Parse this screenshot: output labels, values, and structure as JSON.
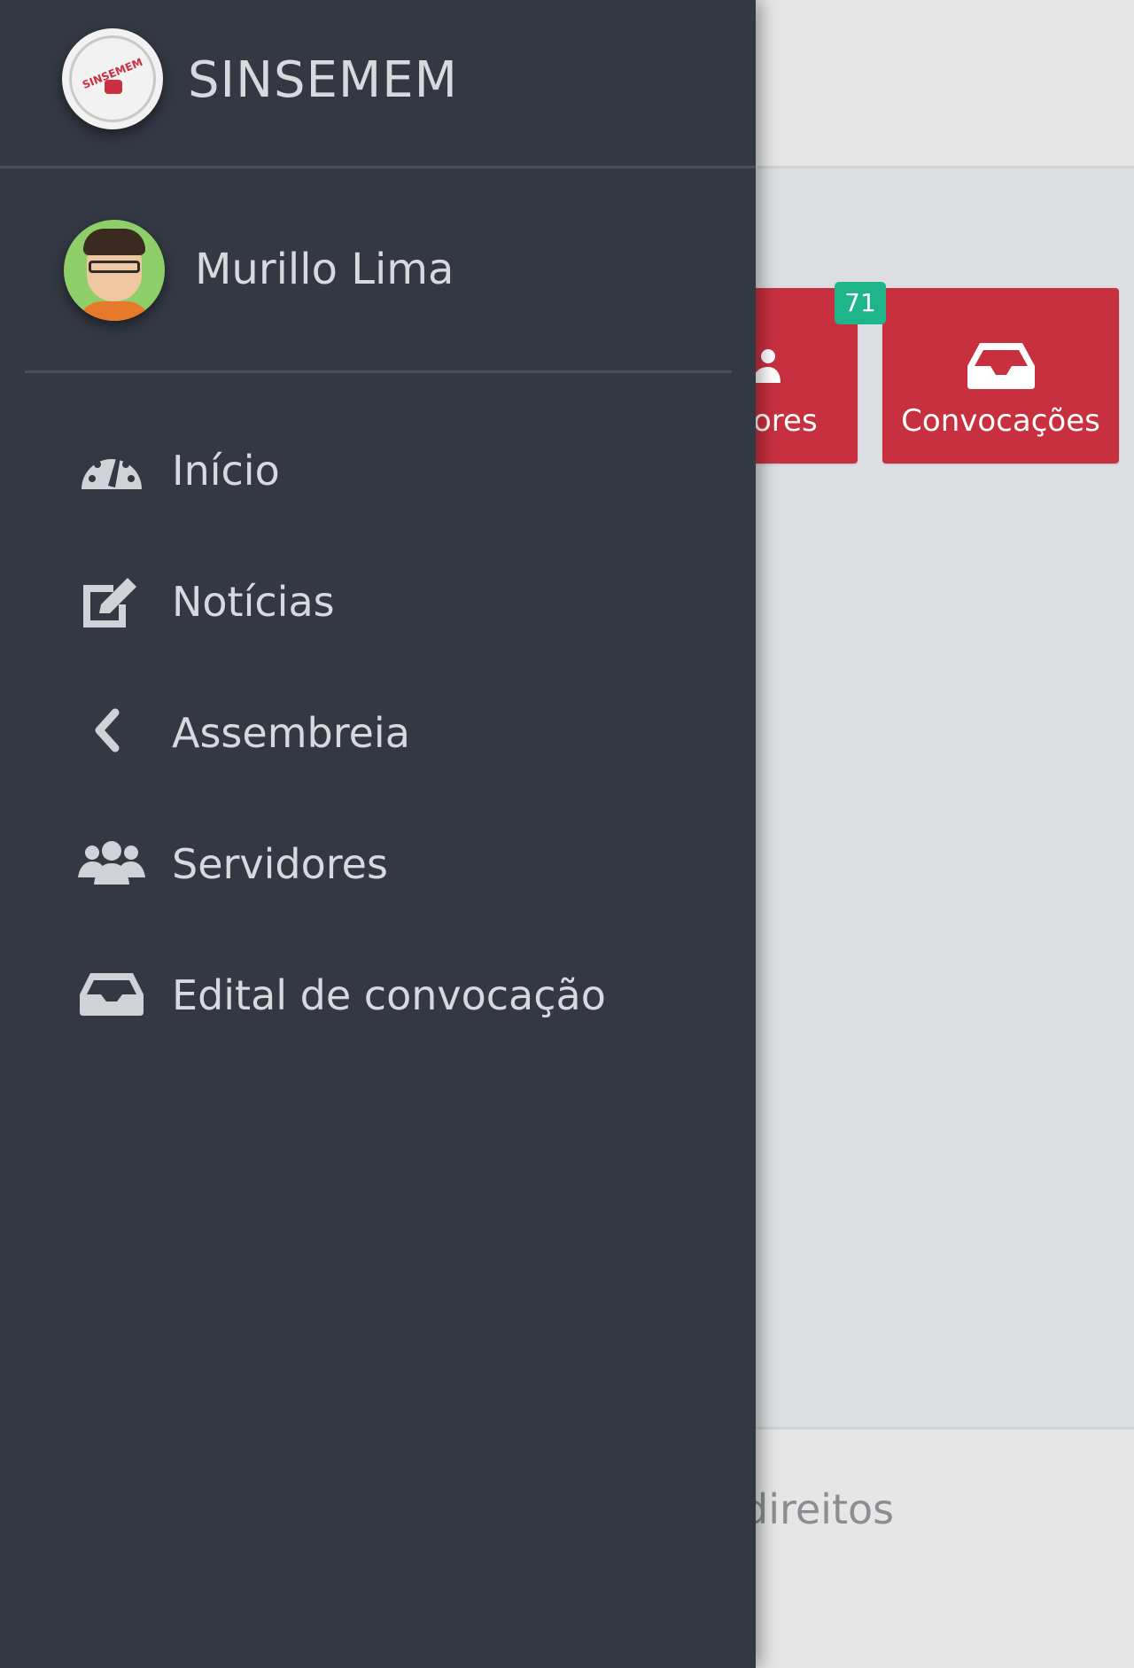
{
  "brand": {
    "name": "SINSEMEM",
    "logo_text": "SINSEMEM"
  },
  "user": {
    "name": "Murillo Lima"
  },
  "nav": {
    "items": [
      {
        "label": "Início",
        "icon": "dashboard-icon"
      },
      {
        "label": "Notícias",
        "icon": "edit-icon"
      },
      {
        "label": "Assembreia",
        "icon": "chevron-left-icon"
      },
      {
        "label": "Servidores",
        "icon": "users-icon"
      },
      {
        "label": "Edital de convocação",
        "icon": "inbox-icon"
      }
    ]
  },
  "background": {
    "tiles": [
      {
        "label": "ores",
        "icon": "users-icon"
      },
      {
        "label": "Convocações",
        "icon": "inbox-icon"
      }
    ],
    "badge": "71",
    "footer_text": "direitos"
  },
  "colors": {
    "drawer": "#343843",
    "tile": "#c8303f",
    "badge": "#1fb58a",
    "text": "#d7d9dd"
  }
}
